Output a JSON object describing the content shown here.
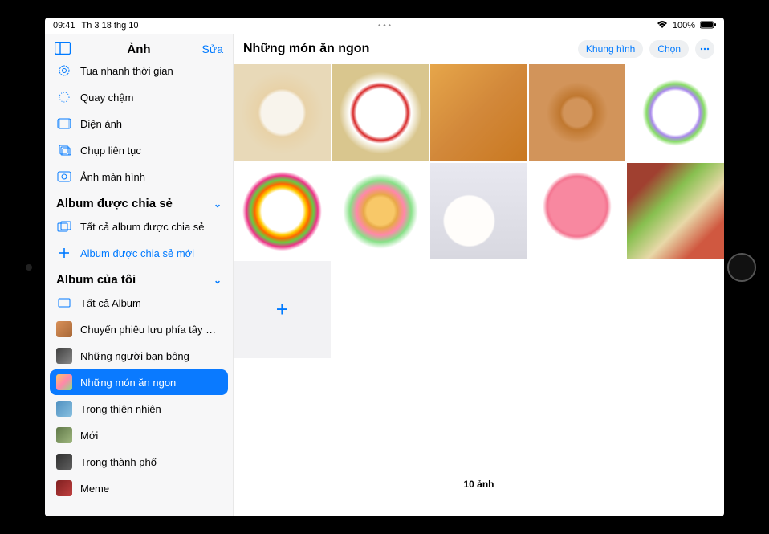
{
  "status": {
    "time": "09:41",
    "date": "Th 3 18 thg 10",
    "center": "• • •",
    "wifi": "100%"
  },
  "sidebar": {
    "title": "Ảnh",
    "edit": "Sửa",
    "mediaTypes": [
      {
        "icon": "timelapse",
        "label": "Tua nhanh thời gian"
      },
      {
        "icon": "slomo",
        "label": "Quay chậm"
      },
      {
        "icon": "cinematic",
        "label": "Điện ảnh"
      },
      {
        "icon": "burst",
        "label": "Chụp liên tục"
      },
      {
        "icon": "screenshot",
        "label": "Ảnh màn hình"
      }
    ],
    "sharedSection": "Album được chia sẻ",
    "sharedItems": [
      {
        "icon": "shared",
        "label": "Tất cả album được chia sẻ"
      },
      {
        "icon": "plus",
        "label": "Album được chia sẻ mới",
        "link": true
      }
    ],
    "mySection": "Album của tôi",
    "myItems": [
      {
        "icon": "all",
        "label": "Tất cả Album"
      },
      {
        "thumb": "th-a",
        "label": "Chuyến phiêu lưu phía tây nam"
      },
      {
        "thumb": "th-b",
        "label": "Những người bạn bông"
      },
      {
        "thumb": "th-c",
        "label": "Những món ăn ngon",
        "selected": true
      },
      {
        "thumb": "th-d",
        "label": "Trong thiên nhiên"
      },
      {
        "thumb": "th-e",
        "label": "Mới"
      },
      {
        "thumb": "th-f",
        "label": "Trong thành phố"
      },
      {
        "thumb": "th-g",
        "label": "Meme"
      }
    ]
  },
  "main": {
    "title": "Những món ăn ngon",
    "actions": {
      "slideshow": "Khung hình",
      "select": "Chọn"
    },
    "count": "10 ảnh",
    "add": "+"
  }
}
